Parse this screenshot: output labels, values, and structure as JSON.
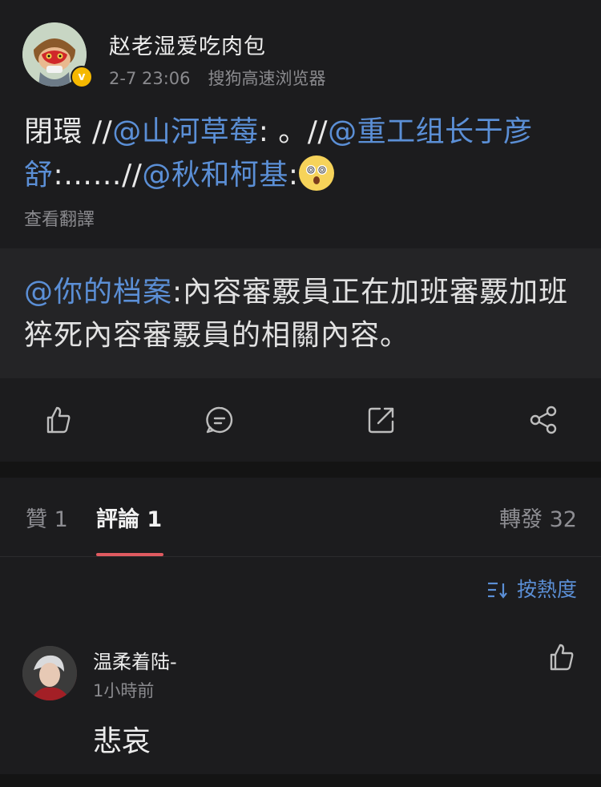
{
  "post": {
    "author": "赵老湿爱吃肉包",
    "time": "2-7 23:06",
    "source": "搜狗高速浏览器",
    "text_prefix": "閉環 //",
    "mention1": "@山河草莓",
    "text_mid1": ": 。//",
    "mention2": "@重工组长于彦舒",
    "text_mid2": ":……//",
    "mention3": "@秋和柯基",
    "text_mid3": ":",
    "emoji": "dizzy-face-emoji",
    "translate": "查看翻譯"
  },
  "quote": {
    "mention": "@你的档案",
    "text": ":內容審覈員正在加班審覈加班猝死內容審覈員的相關內容。"
  },
  "actions": [
    "like-icon",
    "comment-icon",
    "repost-icon",
    "share-icon"
  ],
  "tabs": {
    "like": "贊 1",
    "comment": "評論 1",
    "forward": "轉發 32"
  },
  "sort": {
    "label": "按熱度"
  },
  "comment": {
    "user": "温柔着陆-",
    "time": "1小時前",
    "text": "悲哀"
  },
  "colors": {
    "accent": "#5b8fd6",
    "tab_underline": "#e05a60",
    "badge": "#f5b800"
  }
}
